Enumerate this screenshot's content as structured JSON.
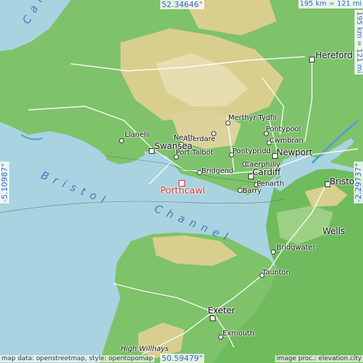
{
  "colors": {
    "sea": "#a9d3e0",
    "lowland": "#7ec26a",
    "upland": "#d8cf8e",
    "highland": "#ece6c8",
    "road": "#ffffff",
    "coord_text": "#3366cc",
    "marker": "#e03030"
  },
  "place": {
    "name": "Porthcawl"
  },
  "coords": {
    "top": "52.34646°",
    "bottom": "50.59479°",
    "left": "-5.10987°",
    "right": "-2.29737°"
  },
  "scale": {
    "horizontal": "195 km = 121 mi",
    "vertical": "195 km = 121 mi"
  },
  "water_labels": {
    "cardigan": "Card",
    "bristol_1": "Bristol",
    "bristol_2": "Channel"
  },
  "towns": {
    "hereford": "Hereford",
    "merthyr": "Merthyr Tydfil",
    "neath": "Neath",
    "aberdare": "Aberdare",
    "pontypool": "Pontypool",
    "cwmbran": "Cwmbran",
    "llanelli": "Llanelli",
    "swansea": "Swansea",
    "port_talbot": "Port Talbot",
    "pontypridd": "Pontypridd",
    "newport": "Newport",
    "caerphilly": "Caerphilly",
    "bridgend": "Bridgend",
    "cardiff": "Cardiff",
    "penarth": "Penarth",
    "barry": "Barry",
    "bristol": "Bristo",
    "wells": "Wells",
    "bridgwater": "Bridgwater",
    "taunton": "Taunton",
    "exeter": "Exeter",
    "exmouth": "Exmouth",
    "high_willhays": "High Willhays"
  },
  "credits": {
    "left": "map data: openstreetmap, style: opentopomap",
    "right": "image proc.: elevation.city"
  }
}
